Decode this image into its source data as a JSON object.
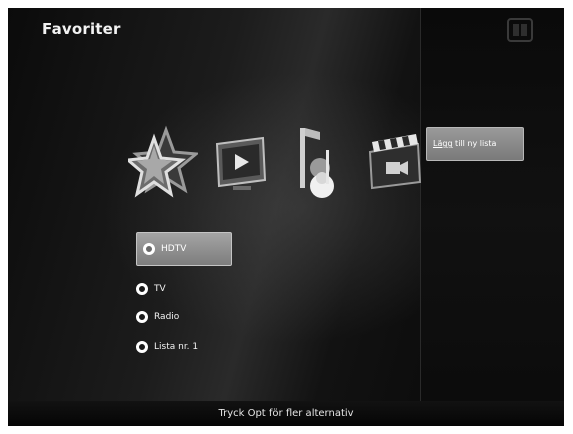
{
  "header": {
    "title": "Favoriter",
    "corner_icon": "hd-logo-icon"
  },
  "categories": [
    {
      "name": "favorites-star",
      "icon": "star-icon",
      "selected": true
    },
    {
      "name": "video",
      "icon": "video-screen-icon",
      "selected": false
    },
    {
      "name": "music",
      "icon": "music-icon",
      "selected": false
    },
    {
      "name": "film",
      "icon": "clapperboard-icon",
      "selected": false
    }
  ],
  "side_menu": {
    "add_label": "Lägg till ny lista",
    "add_label_underlined": "Lägg",
    "add_label_rest": " till ny lista"
  },
  "lists": [
    {
      "label": "HDTV",
      "selected": true
    },
    {
      "label": "TV",
      "selected": false
    },
    {
      "label": "Radio",
      "selected": false
    },
    {
      "label": "Lista nr. 1",
      "selected": false
    }
  ],
  "footer": {
    "hint": "Tryck Opt för fler alternativ"
  },
  "colors": {
    "background": "#1a1a1a",
    "selection": "#8c8c8c",
    "text": "#f2f2f2"
  }
}
